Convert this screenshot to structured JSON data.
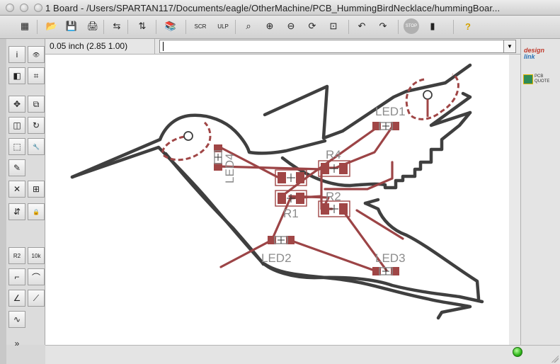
{
  "window": {
    "title": "1 Board - /Users/SPARTAN117/Documents/eagle/OtherMachine/PCB_HummingBirdNecklace/hummingBoar..."
  },
  "toolbar": {
    "buttons": [
      {
        "name": "grid-icon",
        "glyph": "▦"
      },
      {
        "name": "open-icon",
        "glyph": "📂"
      },
      {
        "name": "save-icon",
        "glyph": "💾"
      },
      {
        "name": "print-icon",
        "glyph": "🖨"
      },
      {
        "name": "cam-icon",
        "glyph": "⇆"
      },
      {
        "name": "switch-sch-icon",
        "glyph": "⇅"
      },
      {
        "name": "library-icon",
        "glyph": "📚"
      },
      {
        "name": "script-icon",
        "glyph": "SCR"
      },
      {
        "name": "ulp-icon",
        "glyph": "ULP"
      },
      {
        "name": "zoom-fit-icon",
        "glyph": "⌕"
      },
      {
        "name": "zoom-in-icon",
        "glyph": "⊕"
      },
      {
        "name": "zoom-out-icon",
        "glyph": "⊖"
      },
      {
        "name": "zoom-redraw-icon",
        "glyph": "⟳"
      },
      {
        "name": "zoom-select-icon",
        "glyph": "⊡"
      },
      {
        "name": "undo-icon",
        "glyph": "↶"
      },
      {
        "name": "redo-icon",
        "glyph": "↷"
      },
      {
        "name": "stop-icon",
        "glyph": "STOP"
      },
      {
        "name": "drc-icon",
        "glyph": "▮"
      },
      {
        "name": "help-icon",
        "glyph": "?"
      }
    ]
  },
  "coordinates": {
    "readout": "0.05 inch (2.85 1.00)"
  },
  "command": {
    "value": ""
  },
  "left_tools": [
    {
      "name": "info-icon",
      "glyph": "i"
    },
    {
      "name": "show-icon",
      "glyph": "👁"
    },
    {
      "name": "display-icon",
      "glyph": "◧"
    },
    {
      "name": "mark-icon",
      "glyph": "⌗"
    },
    {
      "name": "move-icon",
      "glyph": "✥"
    },
    {
      "name": "copy-icon",
      "glyph": "⧉"
    },
    {
      "name": "mirror-icon",
      "glyph": "◫"
    },
    {
      "name": "rotate-icon",
      "glyph": "↻"
    },
    {
      "name": "group-icon",
      "glyph": "⬚"
    },
    {
      "name": "change-icon",
      "glyph": "🔧"
    },
    {
      "name": "paste-icon",
      "glyph": "✎"
    },
    {
      "name": "delete-icon",
      "glyph": "✕"
    },
    {
      "name": "add-icon",
      "glyph": "⊞"
    },
    {
      "name": "replace-icon",
      "glyph": "⇵"
    },
    {
      "name": "lock-icon",
      "glyph": "🔒"
    },
    {
      "name": "smash-icon",
      "glyph": "R2"
    },
    {
      "name": "value-icon",
      "glyph": "10k"
    },
    {
      "name": "miter-icon",
      "glyph": "⌐"
    },
    {
      "name": "split-icon",
      "glyph": "⌒"
    },
    {
      "name": "route-icon",
      "glyph": "∠"
    },
    {
      "name": "ripup-icon",
      "glyph": "⟋"
    },
    {
      "name": "wire-icon",
      "glyph": "∿"
    },
    {
      "name": "more-icon",
      "glyph": "»"
    }
  ],
  "board": {
    "labels": {
      "led1": "LED1",
      "r4": "R4",
      "r2": "R2",
      "r1": "R1",
      "led2": "LED2",
      "led3": "LED3",
      "led4": "LED4"
    }
  },
  "right_panel": {
    "designlink_a": "design",
    "designlink_b": "link",
    "pcb_quote_a": "PCB",
    "pcb_quote_b": "QUOTE"
  },
  "colors": {
    "outline": "#3f3f3f",
    "trace": "#9c4446",
    "pad": "#a04646",
    "silk": "#8c8c8c",
    "status_led": "#2fb51a"
  }
}
